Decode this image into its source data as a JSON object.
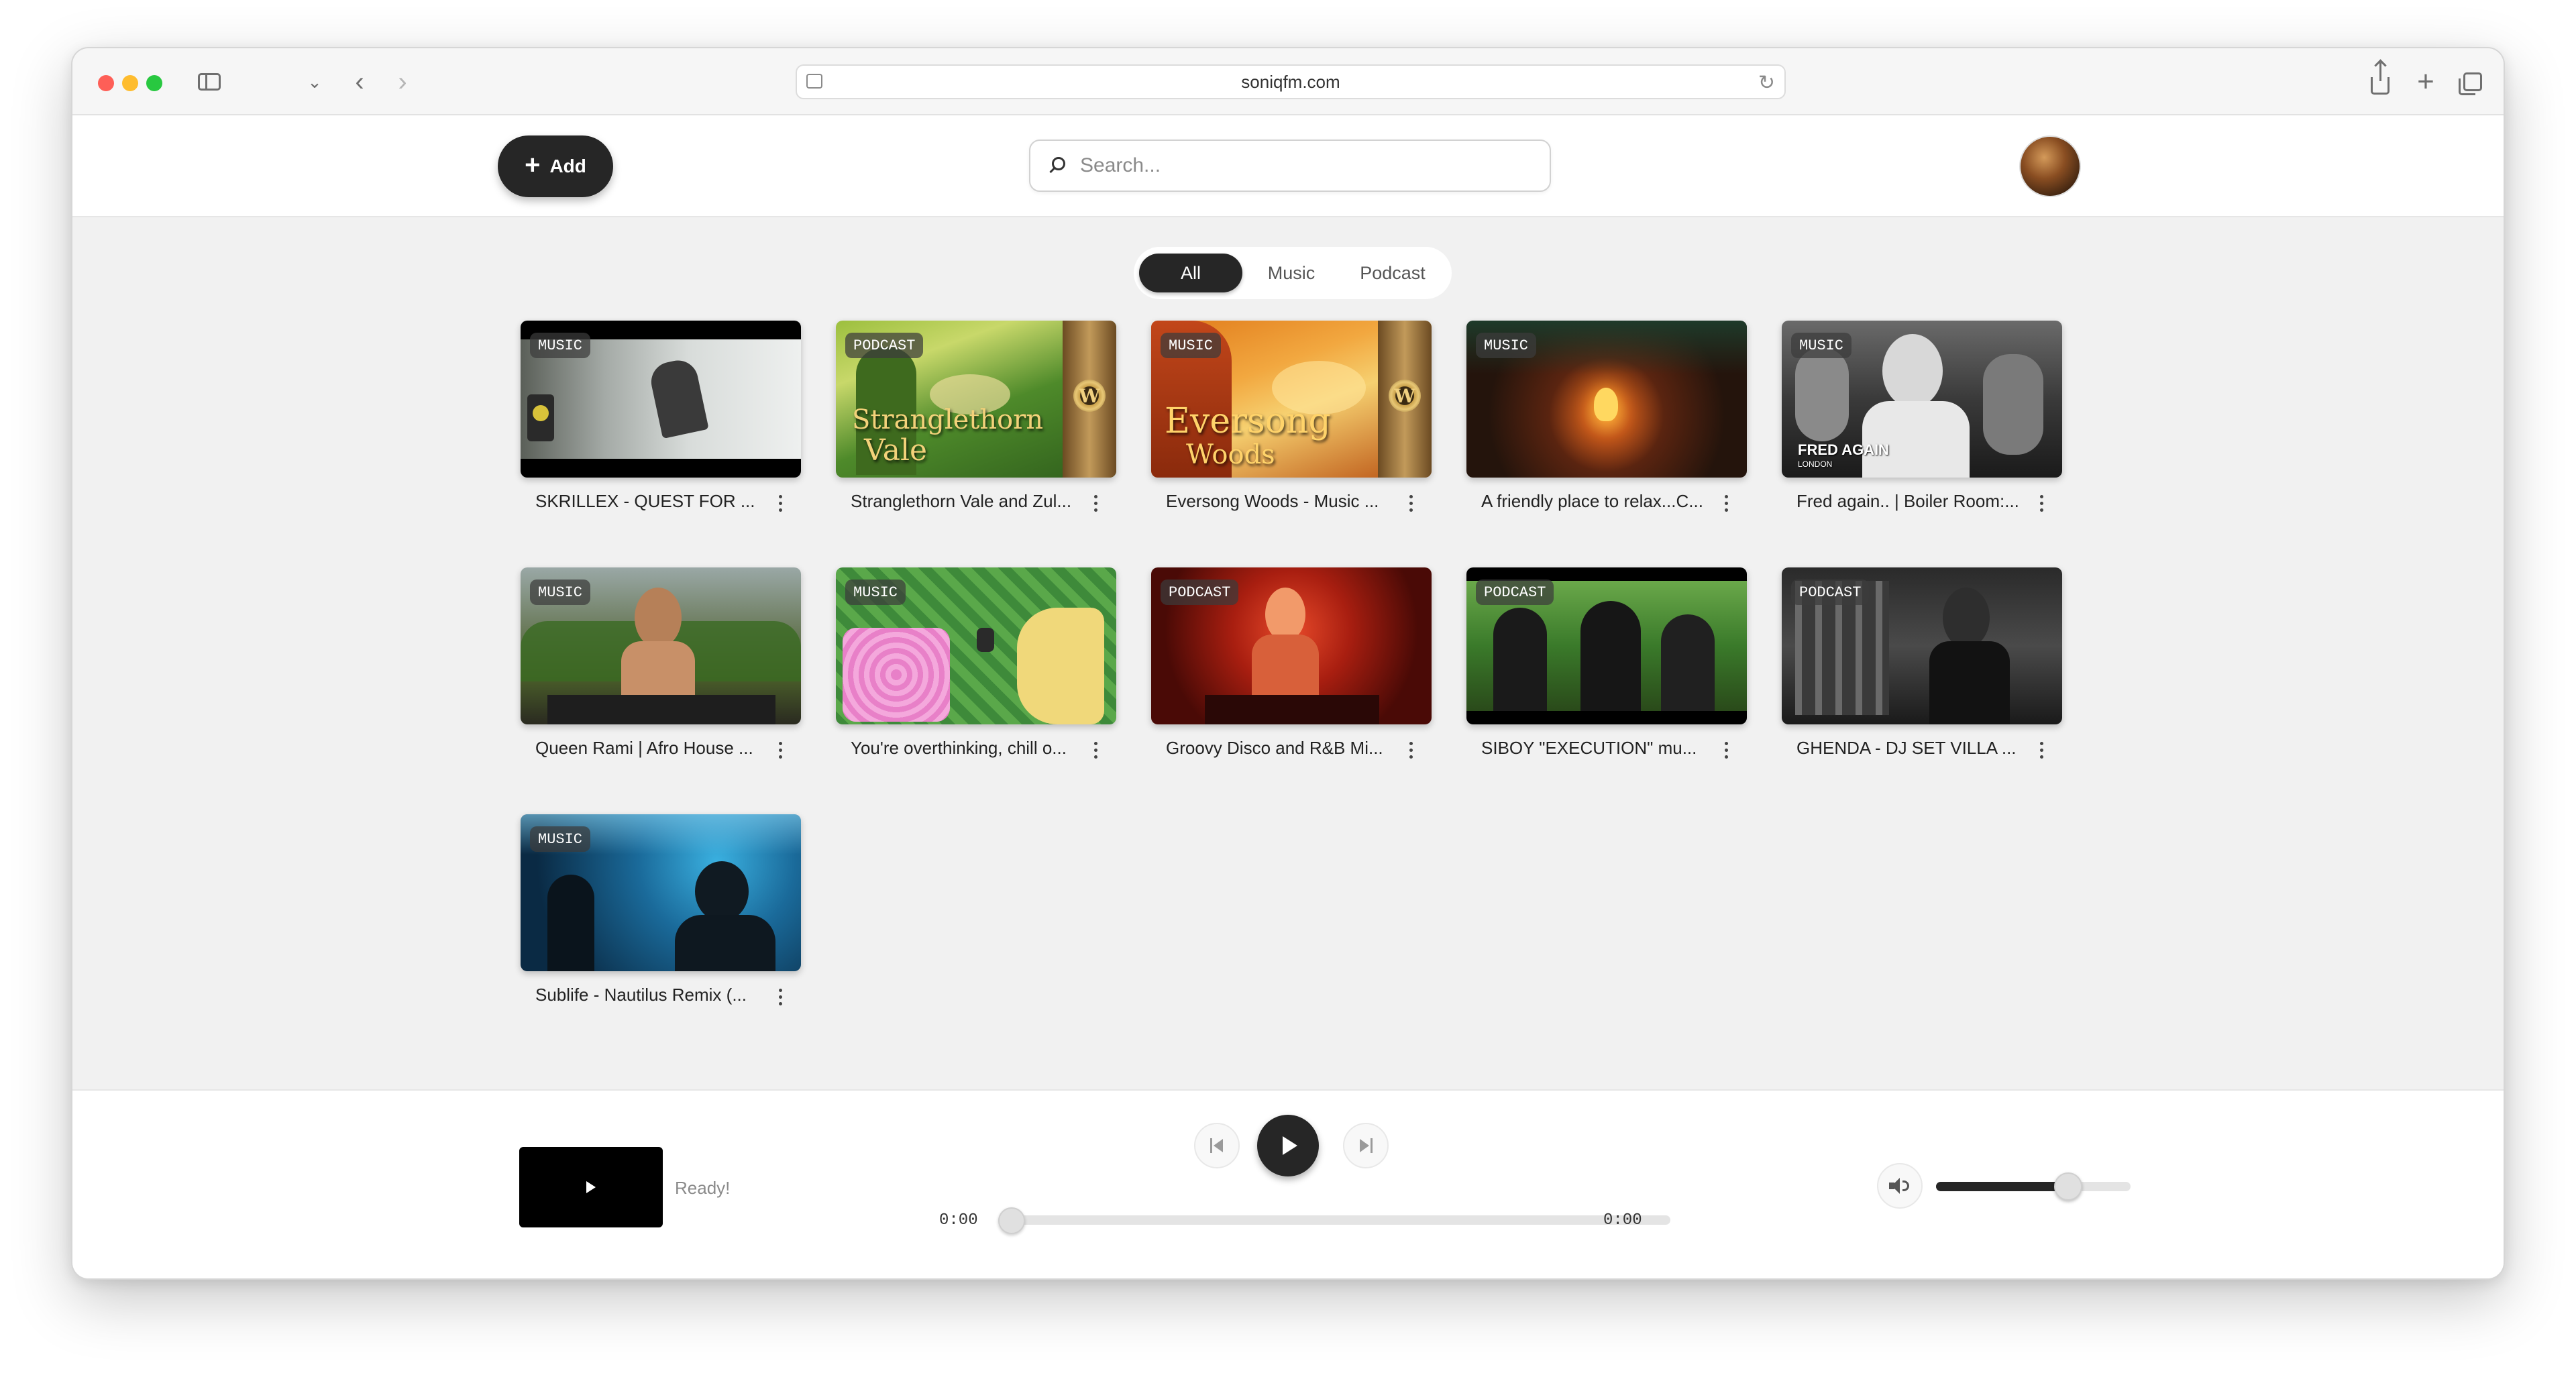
{
  "browser": {
    "url": "soniqfm.com"
  },
  "header": {
    "add_label": "Add",
    "search_placeholder": "Search..."
  },
  "filters": [
    {
      "label": "All",
      "active": true
    },
    {
      "label": "Music",
      "active": false
    },
    {
      "label": "Podcast",
      "active": false
    }
  ],
  "items": [
    {
      "badge": "MUSIC",
      "title": "SKRILLEX - QUEST FOR ...",
      "thumb_icon": "dj-in-white-room"
    },
    {
      "badge": "PODCAST",
      "title": "Stranglethorn Vale and Zul...",
      "thumb_text": [
        "Stranglethorn",
        "Vale"
      ],
      "thumb_icon": "wow-logo-icon"
    },
    {
      "badge": "MUSIC",
      "title": "Eversong Woods - Music ...",
      "thumb_text": [
        "Eversong",
        "Woods"
      ],
      "thumb_icon": "wow-logo-icon"
    },
    {
      "badge": "MUSIC",
      "title": "A friendly place to relax...C...",
      "thumb_icon": "campfire-scene"
    },
    {
      "badge": "MUSIC",
      "title": "Fred again.. | Boiler Room:...",
      "thumb_caption": "FRED AGAIN",
      "thumb_subcaption": "LONDON"
    },
    {
      "badge": "MUSIC",
      "title": "Queen Rami | Afro House ...",
      "thumb_icon": "dj-outdoor-jungle"
    },
    {
      "badge": "MUSIC",
      "title": "You're overthinking, chill o...",
      "thumb_icon": "pixel-art-game-scene"
    },
    {
      "badge": "PODCAST",
      "title": "Groovy Disco and R&B Mi...",
      "thumb_icon": "red-club-dj"
    },
    {
      "badge": "PODCAST",
      "title": "SIBOY \"EXECUTION\" mu...",
      "thumb_icon": "forest-crew"
    },
    {
      "badge": "PODCAST",
      "title": "GHENDA - DJ SET VILLA ...",
      "thumb_icon": "dj-in-dark-villa"
    },
    {
      "badge": "MUSIC",
      "title": "Sublife - Nautilus Remix (...",
      "thumb_icon": "blue-studio-scene"
    }
  ],
  "player": {
    "status": "Ready!",
    "current_time": "0:00",
    "duration": "0:00",
    "progress": 0,
    "volume": 0.68
  }
}
